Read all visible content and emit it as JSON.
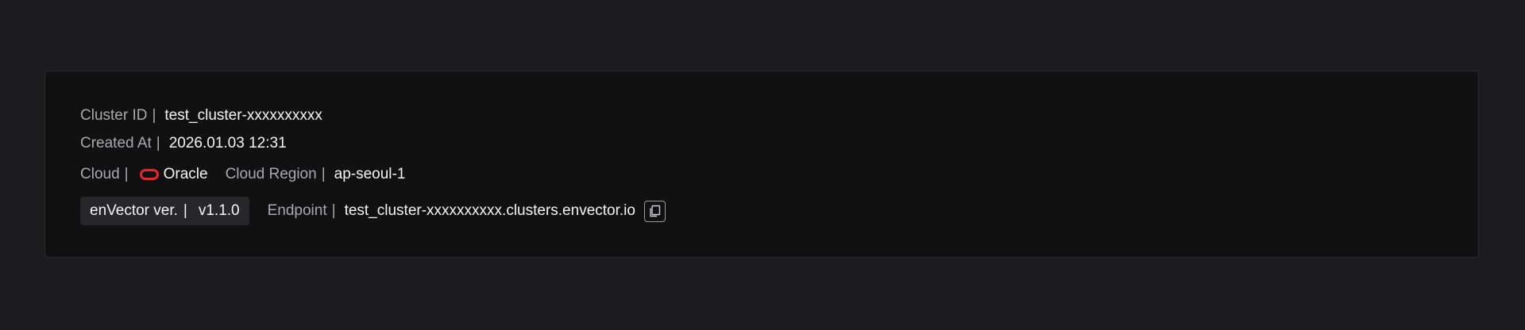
{
  "cluster": {
    "id_label": "Cluster ID",
    "id_value": "test_cluster-xxxxxxxxxx",
    "created_label": "Created At",
    "created_value": "2026.01.03 12:31",
    "cloud_label": "Cloud",
    "cloud_value": "Oracle",
    "cloud_icon": "oracle-logo-icon",
    "region_label": "Cloud Region",
    "region_value": "ap-seoul-1",
    "version_label": "enVector ver.",
    "version_value": "v1.1.0",
    "endpoint_label": "Endpoint",
    "endpoint_value": "test_cluster-xxxxxxxxxx.clusters.envector.io",
    "copy_icon": "copy-icon"
  },
  "separator": "|",
  "colors": {
    "background": "#1c1c1e",
    "card": "#111112",
    "label": "#a9a9ad",
    "value": "#f4f4f5",
    "oracle_red": "#e8262b",
    "chip": "#27272a"
  }
}
